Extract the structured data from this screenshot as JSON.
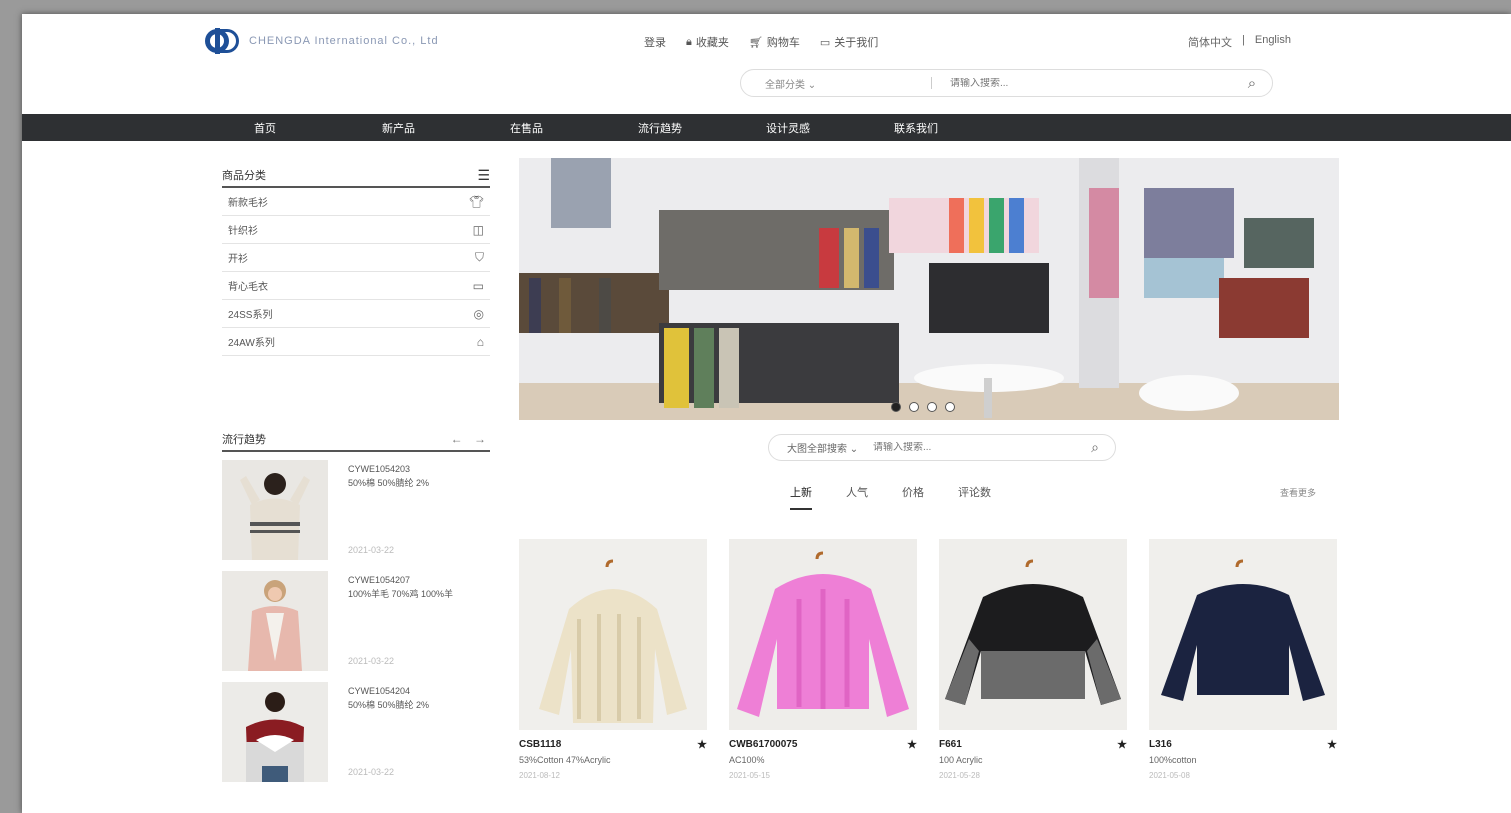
{
  "header": {
    "company_name": "CHENGDA International Co., Ltd",
    "links": [
      {
        "label": "登录",
        "icon": "login-icon"
      },
      {
        "label": "收藏夹",
        "icon": "lock-icon"
      },
      {
        "label": "购物车",
        "icon": "cart-icon"
      },
      {
        "label": "关于我们",
        "icon": "info-icon"
      }
    ],
    "lang": [
      "简体中文",
      "English"
    ]
  },
  "search_top": {
    "category": "全部分类",
    "placeholder": "请输入搜索..."
  },
  "nav": [
    "首页",
    "新产品",
    "在售品",
    "流行趋势",
    "设计灵感",
    "联系我们"
  ],
  "sidebar": {
    "title": "商品分类",
    "items": [
      {
        "label": "新款毛衫",
        "icon": "sweater-icon"
      },
      {
        "label": "针织衫",
        "icon": "knit-icon"
      },
      {
        "label": "开衫",
        "icon": "cardigan-icon"
      },
      {
        "label": "背心毛衣",
        "icon": "vest-icon"
      },
      {
        "label": "24SS系列",
        "icon": "glasses-icon"
      },
      {
        "label": "24AW系列",
        "icon": "basket-icon"
      }
    ]
  },
  "hot": {
    "title": "流行趋势",
    "arrows": "← →",
    "items": [
      {
        "code": "CYWE1054203",
        "desc": "50%棉 50%腈纶 2%",
        "date": "2021-03-22"
      },
      {
        "code": "CYWE1054207",
        "desc": "100%羊毛 70%鸡 100%羊",
        "date": "2021-03-22"
      },
      {
        "code": "CYWE1054204",
        "desc": "50%棉 50%腈纶 2%",
        "date": "2021-03-22"
      }
    ]
  },
  "search_mid": {
    "category": "大图全部搜索",
    "placeholder": "请输入搜索..."
  },
  "tabs": [
    "上新",
    "人气",
    "价格",
    "评论数"
  ],
  "more_label": "查看更多",
  "products": [
    {
      "code": "CSB1118",
      "desc": "53%Cotton 47%Acrylic",
      "date": "2021-08-12"
    },
    {
      "code": "CWB61700075",
      "desc": "AC100%",
      "date": "2021-05-15"
    },
    {
      "code": "F661",
      "desc": "100 Acrylic",
      "date": "2021-05-28"
    },
    {
      "code": "L316",
      "desc": "100%cotton",
      "date": "2021-05-08"
    }
  ]
}
